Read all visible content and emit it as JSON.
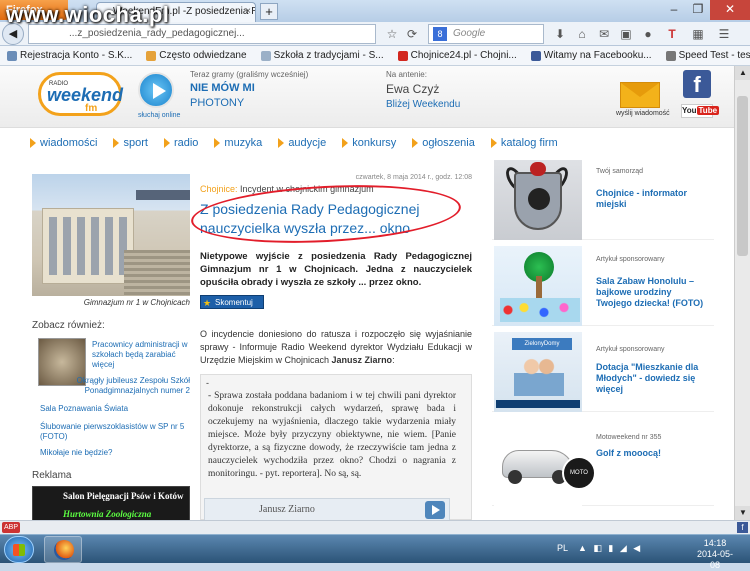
{
  "browser": {
    "menu_button": "Firefox",
    "tab_title": "WeekendFm.pl -Z posiedzenia Rady Ped...",
    "tab_close": "×",
    "new_tab": "+",
    "url": "...z_posiedzenia_rady_pedagogicznej...",
    "search_placeholder": "Google",
    "watermark": "www.wiocha.pl",
    "bookmarks": [
      "Rejestracja Konto - S.K...",
      "Często odwiedzane",
      "Szkoła z tradycjami - S...",
      "Chojnice24.pl - Chojni...",
      "Witamy na Facebooku...",
      "Speed Test - test prędk..."
    ]
  },
  "header": {
    "logo_small": "RADIO",
    "logo_brand": "weekend",
    "logo_fm": "fm",
    "listen_label": "słuchaj online",
    "now_label": "Teraz gramy (graliśmy wcześniej)",
    "now_title": "NIE MÓW MI",
    "now_artist": "PHOTONY",
    "antenna_label": "Na antenie:",
    "antenna_name": "Ewa Czyż",
    "antenna_show": "Bliżej Weekendu",
    "mail_label": "wyślij wiadomość",
    "fb_letter": "f",
    "yt_label": "You",
    "yt_tube": "Tube"
  },
  "menu": [
    "wiadomości",
    "sport",
    "radio",
    "muzyka",
    "audycje",
    "konkursy",
    "ogłoszenia",
    "katalog firm"
  ],
  "article": {
    "photo_caption": "Gimnazjum nr 1 w Chojnicach",
    "date": "czwartek, 8 maja 2014 r., godz. 12:08",
    "category": "Chojnice:",
    "category_rest": " Incydent w chojnickim gimnazjum",
    "headline": "Z posiedzenia Rady Pedagogicznej nauczycielka wyszła przez... okno",
    "lead": "Nietypowe wyjście z posiedzenia Rady Pedagogicznej Gimnazjum nr 1 w Chojnicach. Jedna z nauczycielek opuściła obrady i wyszła ze szkoły ... przez okno.",
    "share_label": "Skomentuj",
    "body_start": "O incydencie doniesiono do ratusza i rozpoczęło się wyjaśnianie sprawy - Informuje Radio Weekend dyrektor Wydziału Edukacji w Urzędzie Miejskim w Chojnicach ",
    "body_name": "Janusz Ziarno",
    "body_end": ":",
    "quote_dash": "-",
    "quote": "- Sprawa została poddana badaniom i w tej chwili pani dyrektor dokonuje rekonstrukcji całych wydarzeń, sprawę bada i oczekujemy na wyjaśnienia, dlaczego takie wydarzenia miały miejsce. Może były przyczyny obiektywne, nie wiem. [Panie dyrektorze, a są fizyczne dowody, że rzeczywiście tam jedna z nauczycielek wychodziła przez okno? Chodzi o nagrania z monitoringu. - pyt. reportera]. No są, są.",
    "player_label": "Janusz Ziarno"
  },
  "sidebar_left": {
    "see_also": "Zobacz również:",
    "links": [
      "Pracownicy administracji w szkołach będą zarabiać więcej",
      "Okrągły jubileusz Zespołu Szkół Ponadgimnazjalnych numer 2",
      "Sala Poznawania Świata",
      "Ślubowanie pierwszoklasistów w SP nr 5 (FOTO)",
      "Mikołaje nie będzie?"
    ],
    "ads_label": "Reklama",
    "ad_line1": "Salon Pielęgnacji Psów i Kotów",
    "ad_line2": "Hurtownia Zoologiczna"
  },
  "sidebar_right": [
    {
      "small": "Twój samorząd",
      "title": "Chojnice - informator miejski"
    },
    {
      "small": "Artykuł sponsorowany",
      "title": "Sala Zabaw Honolulu – bajkowe urodziny Twojego dziecka! (FOTO)"
    },
    {
      "small": "Artykuł sponsorowany",
      "title": "Dotacja \"Mieszkanie dla Młodych\" - dowiedz się więcej"
    },
    {
      "small": "Motoweekend nr 355",
      "title": "Golf z mooocą!"
    }
  ],
  "ad_images": {
    "house_sign": "ZielonyDomy",
    "car_badge": "MOTO"
  },
  "taskbar": {
    "lang": "PL",
    "time": "14:18",
    "date": "2014-05-08"
  }
}
